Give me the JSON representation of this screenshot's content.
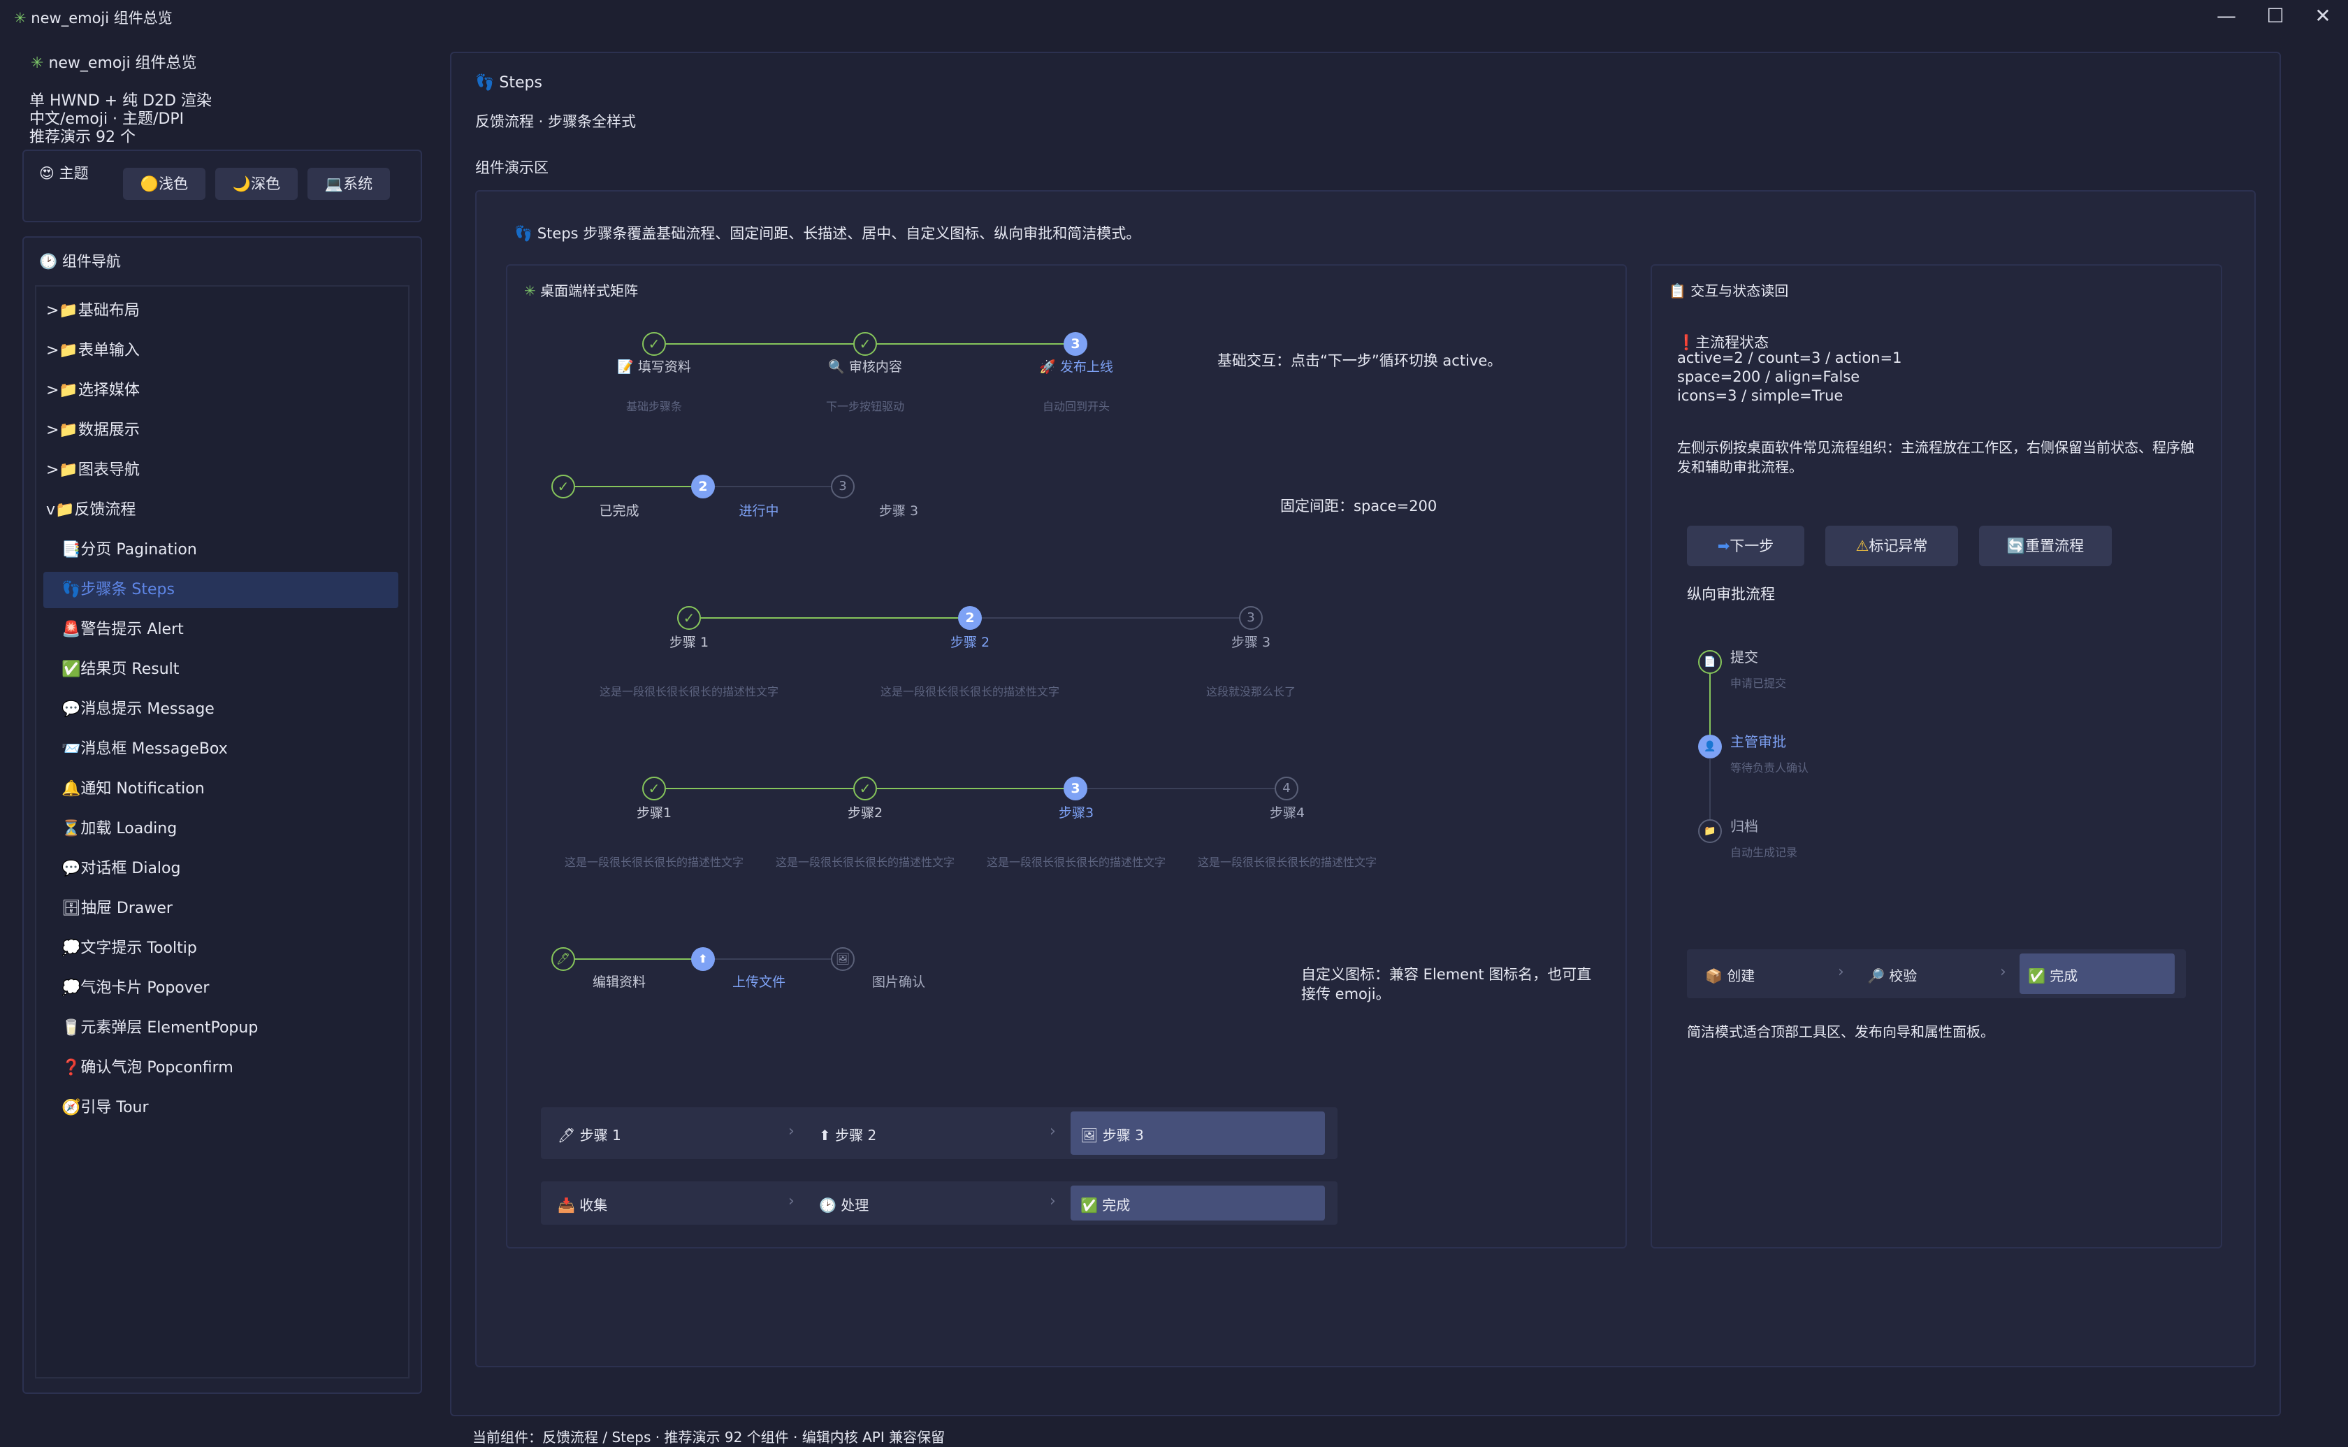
{
  "window": {
    "title": "new_emoji 组件总览",
    "title_icon": "✳"
  },
  "sidebar": {
    "app_title": "new_emoji 组件总览",
    "info": [
      "单 HWND + 纯 D2D 渲染",
      "中文/emoji · 主题/DPI",
      "推荐演示 92 个"
    ],
    "theme": {
      "label": "主题",
      "icon": "😍",
      "buttons": [
        {
          "icon": "🟡",
          "label": "浅色"
        },
        {
          "icon": "🌙",
          "label": "深色"
        },
        {
          "icon": "💻",
          "label": "系统"
        }
      ]
    },
    "nav": {
      "label": "组件导航",
      "icon": "🕑",
      "groups": [
        {
          "prefix": ">📁",
          "label": "基础布局"
        },
        {
          "prefix": ">📁",
          "label": "表单输入"
        },
        {
          "prefix": ">📁",
          "label": "选择媒体"
        },
        {
          "prefix": ">📁",
          "label": "数据展示"
        },
        {
          "prefix": ">📁",
          "label": "图表导航"
        },
        {
          "prefix": "v📁",
          "label": "反馈流程"
        }
      ],
      "items": [
        {
          "icon": "📑",
          "label": "分页 Pagination"
        },
        {
          "icon": "👣",
          "label": "步骤条 Steps"
        },
        {
          "icon": "🚨",
          "label": "警告提示 Alert"
        },
        {
          "icon": "✅",
          "label": "结果页 Result"
        },
        {
          "icon": "💬",
          "label": "消息提示 Message"
        },
        {
          "icon": "📨",
          "label": "消息框 MessageBox"
        },
        {
          "icon": "🔔",
          "label": "通知 Notification"
        },
        {
          "icon": "⏳",
          "label": "加载 Loading"
        },
        {
          "icon": "💬",
          "label": "对话框 Dialog"
        },
        {
          "icon": "🗄",
          "label": "抽屉 Drawer"
        },
        {
          "icon": "💭",
          "label": "文字提示 Tooltip"
        },
        {
          "icon": "💭",
          "label": "气泡卡片 Popover"
        },
        {
          "icon": "🥛",
          "label": "元素弹层 ElementPopup"
        },
        {
          "icon": "❓",
          "label": "确认气泡 Popconfirm"
        },
        {
          "icon": "🧭",
          "label": "引导 Tour"
        }
      ]
    }
  },
  "main": {
    "title": "Steps",
    "subtitle": "反馈流程 · 步骤条全样式",
    "demo_label": "组件演示区",
    "description": "Steps 步骤条覆盖基础流程、固定间距、长描述、居中、自定义图标、纵向审批和简洁模式。",
    "left_card": {
      "title": "桌面端样式矩阵",
      "row1": {
        "steps": [
          {
            "icon": "📝",
            "label": "填写资料",
            "desc": "基础步骤条"
          },
          {
            "icon": "🔍",
            "label": "审核内容",
            "desc": "下一步按钮驱动"
          },
          {
            "icon": "🚀",
            "label": "发布上线",
            "desc": "自动回到开头",
            "num": "3"
          }
        ],
        "note": "基础交互：点击“下一步”循环切换 active。"
      },
      "row2": {
        "steps": [
          {
            "label": "已完成"
          },
          {
            "label": "进行中",
            "num": "2"
          },
          {
            "label": "步骤 3",
            "num": "3"
          }
        ],
        "note": "固定间距：space=200"
      },
      "row3": {
        "steps": [
          {
            "label": "步骤 1",
            "desc": "这是一段很长很长很长的描述性文字"
          },
          {
            "label": "步骤 2",
            "num": "2",
            "desc": "这是一段很长很长很长的描述性文字"
          },
          {
            "label": "步骤 3",
            "num": "3",
            "desc": "这段就没那么长了"
          }
        ]
      },
      "row4": {
        "steps": [
          {
            "label": "步骤1",
            "desc": "这是一段很长很长很长的描述性文字"
          },
          {
            "label": "步骤2",
            "desc": "这是一段很长很长很长的描述性文字"
          },
          {
            "label": "步骤3",
            "num": "3",
            "desc": "这是一段很长很长很长的描述性文字"
          },
          {
            "label": "步骤4",
            "num": "4",
            "desc": "这是一段很长很长很长的描述性文字"
          }
        ]
      },
      "row5": {
        "steps": [
          {
            "icon": "🖊",
            "label": "编辑资料"
          },
          {
            "icon": "⬆",
            "label": "上传文件"
          },
          {
            "icon": "🖼",
            "label": "图片确认"
          }
        ],
        "note": "自定义图标：兼容 Element 图标名，也可直接传 emoji。"
      },
      "simple1": [
        {
          "icon": "🖊",
          "label": "步骤 1"
        },
        {
          "icon": "⬆",
          "label": "步骤 2"
        },
        {
          "icon": "🖼",
          "label": "步骤 3"
        }
      ],
      "simple2": [
        {
          "icon": "📥",
          "label": "收集"
        },
        {
          "icon": "🕑",
          "label": "处理"
        },
        {
          "icon": "✅",
          "label": "完成"
        }
      ]
    },
    "right_card": {
      "title": "交互与状态读回",
      "state_title": "主流程状态",
      "state_lines": [
        "active=2 / count=3 / action=1",
        "space=200 / align=False",
        "icons=3 / simple=True"
      ],
      "explain": "左侧示例按桌面软件常见流程组织：主流程放在工作区，右侧保留当前状态、程序触发和辅助审批流程。",
      "buttons": [
        {
          "icon": "➡",
          "label": "下一步"
        },
        {
          "icon": "⚠",
          "label": "标记异常"
        },
        {
          "icon": "🔄",
          "label": "重置流程"
        }
      ],
      "vertical_title": "纵向审批流程",
      "vertical": [
        {
          "icon": "📄",
          "label": "提交",
          "desc": "申请已提交"
        },
        {
          "icon": "👤",
          "label": "主管审批",
          "desc": "等待负责人确认"
        },
        {
          "icon": "📁",
          "label": "归档",
          "desc": "自动生成记录"
        }
      ],
      "simple": [
        {
          "icon": "📦",
          "label": "创建"
        },
        {
          "icon": "🔎",
          "label": "校验"
        },
        {
          "icon": "✅",
          "label": "完成"
        }
      ],
      "simple_note": "简洁模式适合顶部工具区、发布向导和属性面板。"
    },
    "status_bar": "当前组件：反馈流程 / Steps · 推荐演示 92 个组件 · 编辑内核 API 兼容保留"
  }
}
